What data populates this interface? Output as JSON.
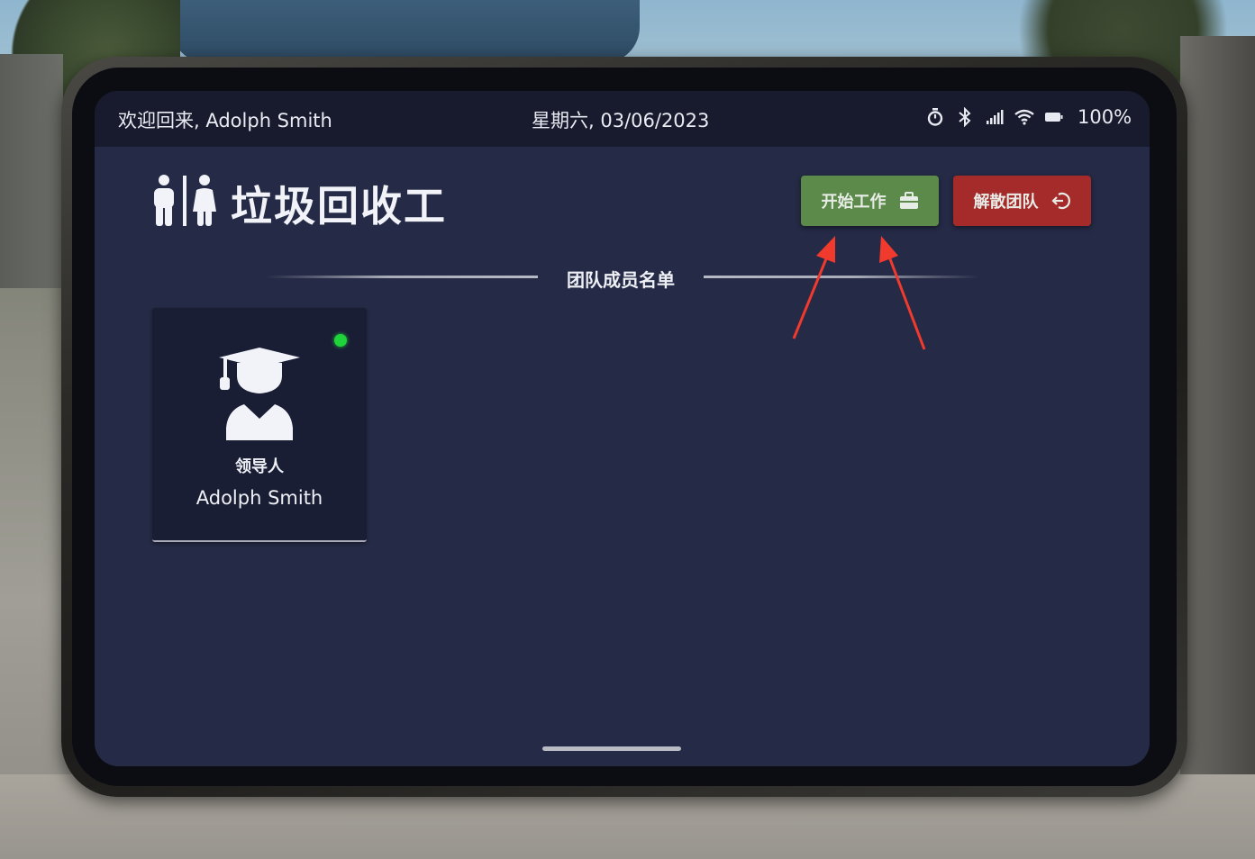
{
  "status_bar": {
    "greeting": "欢迎回来, Adolph Smith",
    "date": "星期六, 03/06/2023",
    "battery": "100%",
    "icons": [
      "stopwatch-icon",
      "bluetooth-icon",
      "signal-icon",
      "wifi-icon",
      "battery-icon"
    ]
  },
  "header": {
    "icon": "restroom-icon",
    "title": "垃圾回收工"
  },
  "actions": {
    "start_label": "开始工作",
    "start_icon": "briefcase-icon",
    "start_color": "#5c8a4a",
    "disband_label": "解散团队",
    "disband_icon": "sign-out-icon",
    "disband_color": "#a52a2a"
  },
  "team": {
    "section_label": "团队成员名单",
    "members": [
      {
        "role": "领导人",
        "name": "Adolph Smith",
        "icon": "graduate-icon",
        "online": true,
        "status_color": "#1ed43a"
      }
    ]
  },
  "annotation": {
    "arrow_color": "#f03a2e"
  }
}
